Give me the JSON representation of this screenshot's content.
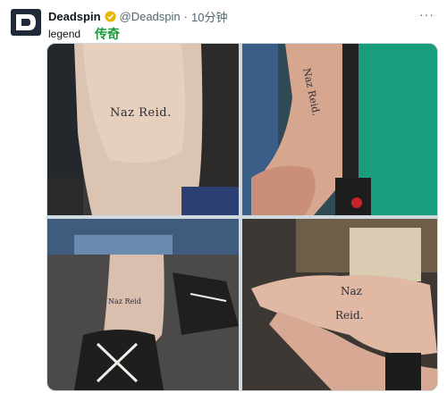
{
  "tweet": {
    "author_name": "Deadspin",
    "handle": "@Deadspin",
    "separator": "·",
    "time": "10分钟",
    "more_label": "···",
    "text": "legend",
    "translation": "传奇"
  },
  "photos": [
    {
      "tattoo_text": "Naz Reid."
    },
    {
      "tattoo_text": "Naz Reid."
    },
    {
      "tattoo_text": "Naz Reid"
    },
    {
      "tattoo_line1": "Naz",
      "tattoo_line2": "Reid."
    }
  ],
  "colors": {
    "avatar_bg": "#1f2a38",
    "verified": "#e8b400",
    "translation": "#1a9b3a"
  },
  "icons": {
    "avatar": "deadspin-logo",
    "verified": "verified-badge-icon",
    "more": "more-options-icon"
  }
}
